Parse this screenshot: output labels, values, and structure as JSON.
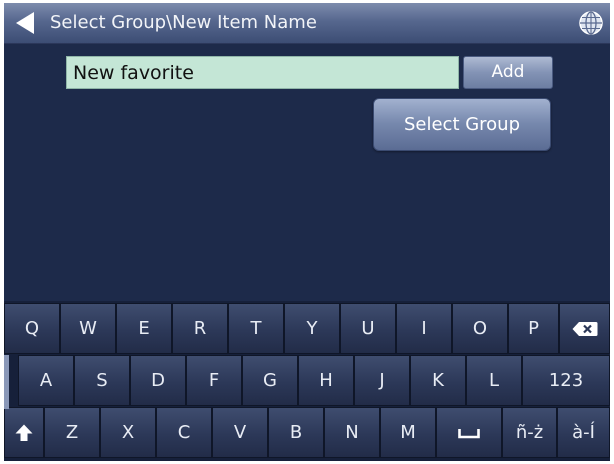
{
  "header": {
    "title": "Select Group\\New Item Name"
  },
  "form": {
    "name_value": "New favorite",
    "add_label": "Add",
    "select_group_label": "Select Group"
  },
  "keyboard": {
    "row1": [
      "Q",
      "W",
      "E",
      "R",
      "T",
      "Y",
      "U",
      "I",
      "O",
      "P"
    ],
    "row2": [
      "A",
      "S",
      "D",
      "F",
      "G",
      "H",
      "J",
      "K",
      "L"
    ],
    "row2_mode_label": "123",
    "row3": [
      "Z",
      "X",
      "C",
      "V",
      "B",
      "N",
      "M"
    ],
    "accent1_label": "ñ-ż",
    "accent2_label": "à-Í"
  },
  "icons": {
    "back": "back-arrow-icon",
    "globe": "globe-icon",
    "backspace": "backspace-icon",
    "shift": "shift-icon",
    "space": "space-icon"
  },
  "colors": {
    "background": "#1d2a4a",
    "input_background": "#c4e6d6"
  }
}
